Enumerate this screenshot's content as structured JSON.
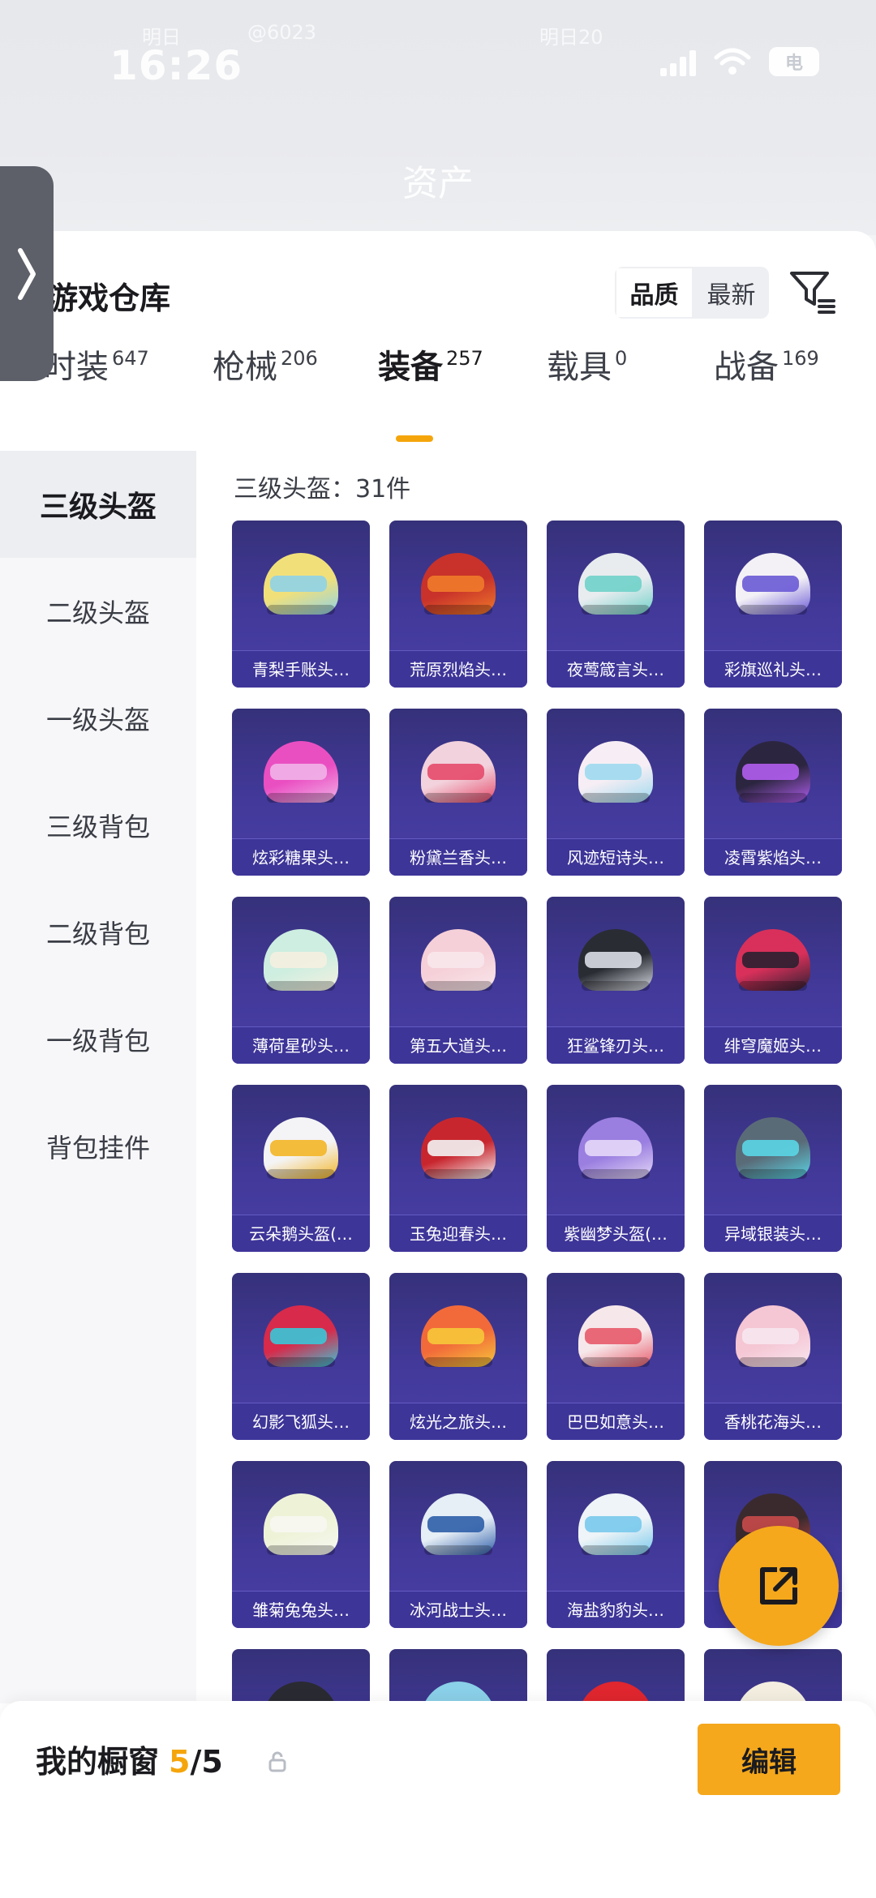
{
  "status_bar": {
    "time": "16:26",
    "ghost_left": "明日",
    "ghost_mid": "@6023",
    "ghost_right": "明日20",
    "battery": "电"
  },
  "header": {
    "title": "资产"
  },
  "warehouse": {
    "title": "游戏仓库"
  },
  "sort": {
    "options": [
      "品质",
      "最新"
    ],
    "selected": "最新"
  },
  "categories": [
    {
      "name": "时装",
      "count": "647"
    },
    {
      "name": "枪械",
      "count": "206"
    },
    {
      "name": "装备",
      "count": "257"
    },
    {
      "name": "载具",
      "count": "0"
    },
    {
      "name": "战备",
      "count": "169"
    }
  ],
  "active_category": "装备",
  "subcategories": [
    "三级头盔",
    "二级头盔",
    "一级头盔",
    "三级背包",
    "二级背包",
    "一级背包",
    "背包挂件"
  ],
  "active_subcategory": "三级头盔",
  "count_label": "三级头盔：31件",
  "items": [
    {
      "name": "青梨手账头…",
      "colors": [
        "#f1e07a",
        "#8fd3e8"
      ]
    },
    {
      "name": "荒原烈焰头…",
      "colors": [
        "#c8322a",
        "#f07a2a"
      ]
    },
    {
      "name": "夜莺箴言头…",
      "colors": [
        "#e8ecef",
        "#6fd1c9"
      ]
    },
    {
      "name": "彩旗巡礼头…",
      "colors": [
        "#f4f1f6",
        "#6a5ad6"
      ]
    },
    {
      "name": "炫彩糖果头…",
      "colors": [
        "#ea4fc2",
        "#f1b3e8"
      ]
    },
    {
      "name": "粉黛兰香头…",
      "colors": [
        "#f2d2dc",
        "#e64a6a"
      ]
    },
    {
      "name": "风迹短诗头…",
      "colors": [
        "#f6eef4",
        "#9ed9ef"
      ]
    },
    {
      "name": "凌霄紫焰头…",
      "colors": [
        "#2c2540",
        "#b15ef0"
      ]
    },
    {
      "name": "薄荷星砂头…",
      "colors": [
        "#cdeee0",
        "#f5f0e0"
      ]
    },
    {
      "name": "第五大道头…",
      "colors": [
        "#f6d0d8",
        "#f8e7ec"
      ]
    },
    {
      "name": "狂鲨锋刃头…",
      "colors": [
        "#2a2c34",
        "#d9dde4"
      ]
    },
    {
      "name": "绯穹魔姬头…",
      "colors": [
        "#d8305a",
        "#2b2030"
      ]
    },
    {
      "name": "云朵鹅头盔(…",
      "colors": [
        "#f4f4f6",
        "#f3b627"
      ]
    },
    {
      "name": "玉兔迎春头…",
      "colors": [
        "#c8262e",
        "#f3f3f3"
      ]
    },
    {
      "name": "紫幽梦头盔(…",
      "colors": [
        "#9a7ee0",
        "#e4d8f8"
      ]
    },
    {
      "name": "异域银装头…",
      "colors": [
        "#5a6b78",
        "#5ad6e6"
      ]
    },
    {
      "name": "幻影飞狐头…",
      "colors": [
        "#d82a4a",
        "#3ac6d8"
      ]
    },
    {
      "name": "炫光之旅头…",
      "colors": [
        "#f26a3a",
        "#f6c83a"
      ]
    },
    {
      "name": "巴巴如意头…",
      "colors": [
        "#f6e8ea",
        "#e85a6a"
      ]
    },
    {
      "name": "香桃花海头…",
      "colors": [
        "#f5c6d4",
        "#f7e6ee"
      ]
    },
    {
      "name": "雏菊兔兔头…",
      "colors": [
        "#eef3d8",
        "#f7f7f2"
      ]
    },
    {
      "name": "冰河战士头…",
      "colors": [
        "#e6eef6",
        "#2e5ea8"
      ]
    },
    {
      "name": "海盐豹豹头…",
      "colors": [
        "#eef4f7",
        "#78c9ec"
      ]
    },
    {
      "name": "",
      "colors": [
        "#3a2a2e",
        "#c94a4a"
      ]
    },
    {
      "name": "",
      "colors": [
        "#2a2a32",
        "#6a6a78"
      ]
    },
    {
      "name": "",
      "colors": [
        "#8ad0e8",
        "#e6f4fa"
      ]
    },
    {
      "name": "",
      "colors": [
        "#e0262e",
        "#f06a6a"
      ]
    },
    {
      "name": "",
      "colors": [
        "#f3eee0",
        "#e8c86a"
      ]
    }
  ],
  "showcase": {
    "label": "我的橱窗",
    "current": "5",
    "total": "/5"
  },
  "edit_button": "编辑",
  "accent_color": "#f5a50c"
}
